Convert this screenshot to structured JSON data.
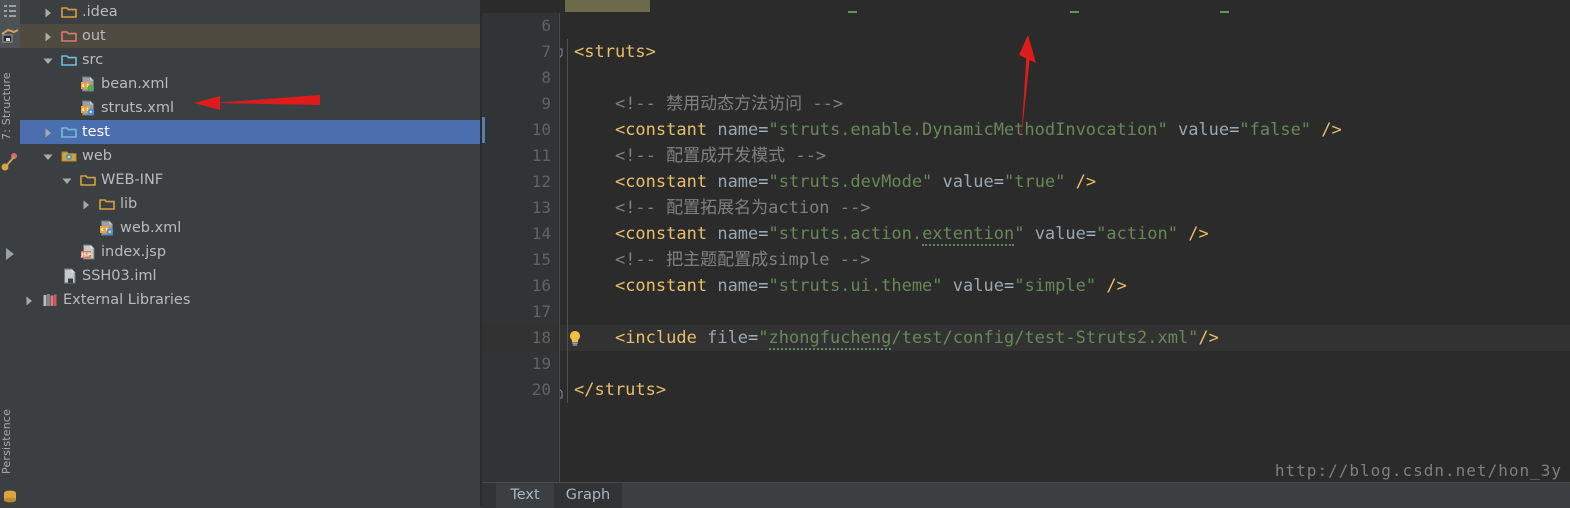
{
  "window": {
    "background": "#3c3f41",
    "editor_background": "#2b2b2b",
    "accent_selection": "#4b6eaf"
  },
  "toolstrip": {
    "buttons": [
      {
        "name": "project-icon",
        "label": ""
      },
      {
        "name": "structure-icon",
        "label": ""
      }
    ],
    "labels": [
      {
        "text": "7: Structure",
        "name": "tool-window-structure"
      },
      {
        "text": "Persistence",
        "name": "tool-window-persistence"
      }
    ]
  },
  "project_tree": {
    "name": "project-tool-window",
    "items": [
      {
        "label": ".idea",
        "indent": 0,
        "arrow": "collapsed",
        "icon": "folder-yellow-icon",
        "state": "normal"
      },
      {
        "label": "out",
        "indent": 0,
        "arrow": "collapsed",
        "icon": "folder-red-icon",
        "state": "highlight"
      },
      {
        "label": "src",
        "indent": 0,
        "arrow": "expanded",
        "icon": "folder-blue-icon",
        "state": "normal"
      },
      {
        "label": "bean.xml",
        "indent": 1,
        "arrow": "none",
        "icon": "xml-spring-file-icon",
        "state": "normal"
      },
      {
        "label": "struts.xml",
        "indent": 1,
        "arrow": "none",
        "icon": "xml-struts-file-icon",
        "state": "normal"
      },
      {
        "label": "test",
        "indent": 0,
        "arrow": "collapsed",
        "icon": "folder-blue-icon",
        "state": "selected"
      },
      {
        "label": "web",
        "indent": 0,
        "arrow": "expanded",
        "icon": "folder-web-icon",
        "state": "normal"
      },
      {
        "label": "WEB-INF",
        "indent": 1,
        "arrow": "expanded",
        "icon": "folder-yellow-icon",
        "state": "normal"
      },
      {
        "label": "lib",
        "indent": 2,
        "arrow": "collapsed",
        "icon": "folder-yellow-icon",
        "state": "normal"
      },
      {
        "label": "web.xml",
        "indent": 2,
        "arrow": "none",
        "icon": "xml-web-file-icon",
        "state": "normal"
      },
      {
        "label": "index.jsp",
        "indent": 1,
        "arrow": "none",
        "icon": "jsp-file-icon",
        "state": "normal"
      },
      {
        "label": "SSH03.iml",
        "indent": 0,
        "arrow": "none",
        "icon": "iml-file-icon",
        "state": "normal"
      },
      {
        "label": "External Libraries",
        "indent": -1,
        "arrow": "collapsed",
        "icon": "libraries-icon",
        "state": "normal"
      }
    ],
    "annotation": {
      "name": "red-arrow-pointer",
      "points_to": "struts.xml"
    }
  },
  "editor": {
    "name": "xml-editor",
    "filename": "struts.xml",
    "first_visible_line": 6,
    "current_line": 18,
    "lines": [
      {
        "no": 6,
        "tokens": []
      },
      {
        "no": 7,
        "fold": "open",
        "tokens": [
          {
            "t": "tag",
            "v": "<struts>"
          }
        ]
      },
      {
        "no": 8,
        "tokens": []
      },
      {
        "no": 9,
        "tokens": [
          {
            "t": "ind",
            "v": "    "
          },
          {
            "t": "cmt",
            "v": "<!-- 禁用动态方法访问 -->"
          }
        ]
      },
      {
        "no": 10,
        "tokens": [
          {
            "t": "ind",
            "v": "    "
          },
          {
            "t": "tag",
            "v": "<constant"
          },
          {
            "t": "plain",
            "v": " "
          },
          {
            "t": "attr",
            "v": "name"
          },
          {
            "t": "eq",
            "v": "="
          },
          {
            "t": "str",
            "v": "\"struts.enable.DynamicMethodInvocation\""
          },
          {
            "t": "plain",
            "v": " "
          },
          {
            "t": "attr",
            "v": "value"
          },
          {
            "t": "eq",
            "v": "="
          },
          {
            "t": "str",
            "v": "\"false\""
          },
          {
            "t": "plain",
            "v": " "
          },
          {
            "t": "tag",
            "v": "/>"
          }
        ]
      },
      {
        "no": 11,
        "tokens": [
          {
            "t": "ind",
            "v": "    "
          },
          {
            "t": "cmt",
            "v": "<!-- 配置成开发模式 -->"
          }
        ]
      },
      {
        "no": 12,
        "tokens": [
          {
            "t": "ind",
            "v": "    "
          },
          {
            "t": "tag",
            "v": "<constant"
          },
          {
            "t": "plain",
            "v": " "
          },
          {
            "t": "attr",
            "v": "name"
          },
          {
            "t": "eq",
            "v": "="
          },
          {
            "t": "str",
            "v": "\"struts.devMode\""
          },
          {
            "t": "plain",
            "v": " "
          },
          {
            "t": "attr",
            "v": "value"
          },
          {
            "t": "eq",
            "v": "="
          },
          {
            "t": "str",
            "v": "\"true\""
          },
          {
            "t": "plain",
            "v": " "
          },
          {
            "t": "tag",
            "v": "/>"
          }
        ]
      },
      {
        "no": 13,
        "tokens": [
          {
            "t": "ind",
            "v": "    "
          },
          {
            "t": "cmt",
            "v": "<!-- 配置拓展名为action -->"
          }
        ]
      },
      {
        "no": 14,
        "tokens": [
          {
            "t": "ind",
            "v": "    "
          },
          {
            "t": "tag",
            "v": "<constant"
          },
          {
            "t": "plain",
            "v": " "
          },
          {
            "t": "attr",
            "v": "name"
          },
          {
            "t": "eq",
            "v": "="
          },
          {
            "t": "str",
            "v": "\"struts.action."
          },
          {
            "t": "str-squig",
            "v": "extention"
          },
          {
            "t": "str",
            "v": "\""
          },
          {
            "t": "plain",
            "v": " "
          },
          {
            "t": "attr",
            "v": "value"
          },
          {
            "t": "eq",
            "v": "="
          },
          {
            "t": "str",
            "v": "\"action\""
          },
          {
            "t": "plain",
            "v": " "
          },
          {
            "t": "tag",
            "v": "/>"
          }
        ]
      },
      {
        "no": 15,
        "tokens": [
          {
            "t": "ind",
            "v": "    "
          },
          {
            "t": "cmt",
            "v": "<!-- 把主题配置成simple -->"
          }
        ]
      },
      {
        "no": 16,
        "tokens": [
          {
            "t": "ind",
            "v": "    "
          },
          {
            "t": "tag",
            "v": "<constant"
          },
          {
            "t": "plain",
            "v": " "
          },
          {
            "t": "attr",
            "v": "name"
          },
          {
            "t": "eq",
            "v": "="
          },
          {
            "t": "str",
            "v": "\"struts.ui.theme\""
          },
          {
            "t": "plain",
            "v": " "
          },
          {
            "t": "attr",
            "v": "value"
          },
          {
            "t": "eq",
            "v": "="
          },
          {
            "t": "str",
            "v": "\"simple\""
          },
          {
            "t": "plain",
            "v": " "
          },
          {
            "t": "tag",
            "v": "/>"
          }
        ]
      },
      {
        "no": 17,
        "tokens": []
      },
      {
        "no": 18,
        "bulb": true,
        "current": true,
        "tokens": [
          {
            "t": "ind",
            "v": "    "
          },
          {
            "t": "tag",
            "v": "<include"
          },
          {
            "t": "plain",
            "v": " "
          },
          {
            "t": "attr",
            "v": "file"
          },
          {
            "t": "eq",
            "v": "="
          },
          {
            "t": "str",
            "v": "\""
          },
          {
            "t": "str-squig",
            "v": "zhongfucheng"
          },
          {
            "t": "str",
            "v": "/test/config/test-Struts2.xml\""
          },
          {
            "t": "tag",
            "v": "/>"
          }
        ]
      },
      {
        "no": 19,
        "tokens": []
      },
      {
        "no": 20,
        "fold": "close",
        "tokens": [
          {
            "t": "tag",
            "v": "</struts>"
          }
        ]
      }
    ],
    "annotation": {
      "name": "red-arrow-pointer",
      "points_to": "include-file-path"
    }
  },
  "bottom_tabs": {
    "name": "editor-view-tabs",
    "tabs": [
      {
        "label": "Text",
        "active": true
      },
      {
        "label": "Graph",
        "active": false
      }
    ]
  },
  "watermark": {
    "text": "http://blog.csdn.net/hon_3y"
  },
  "colors": {
    "tag": "#e8bf6a",
    "attribute": "#9ba7b0",
    "string": "#6a8759",
    "comment": "#808080",
    "line_number": "#606366",
    "selection": "#4b6eaf",
    "arrow_annotation": "#e01b1b"
  }
}
